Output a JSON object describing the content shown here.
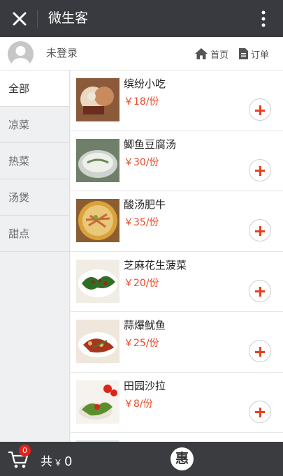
{
  "header": {
    "title": "微生客",
    "close_icon": "close-icon",
    "more_icon": "more-vertical-icon"
  },
  "userbar": {
    "username": "未登录",
    "home_label": "首页",
    "order_label": "订单"
  },
  "categories": [
    "全部",
    "凉菜",
    "热菜",
    "汤煲",
    "甜点"
  ],
  "dishes": [
    {
      "name": "缤纷小吃",
      "price": "￥18/份"
    },
    {
      "name": "鲫鱼豆腐汤",
      "price": "￥30/份"
    },
    {
      "name": "酸汤肥牛",
      "price": "￥35/份"
    },
    {
      "name": "芝麻花生菠菜",
      "price": "￥20/份"
    },
    {
      "name": "蒜爆鱿鱼",
      "price": "￥25/份"
    },
    {
      "name": "田园沙拉",
      "price": "￥8/份"
    }
  ],
  "cart": {
    "badge": "0",
    "total_label": "共",
    "currency": "￥",
    "amount": "0",
    "promo": "惠"
  },
  "colors": {
    "topbar": "#393a3f",
    "price": "#e84b2b",
    "accent": "#e6401f",
    "bottombar": "#3b3c40"
  }
}
